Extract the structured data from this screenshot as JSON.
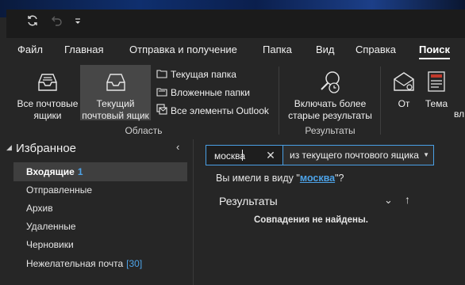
{
  "quick_access": {
    "sync_icon": "sync-icon",
    "undo_icon": "undo-icon",
    "more_icon": "customize-quick-access-icon"
  },
  "tabs": [
    {
      "label": "Файл"
    },
    {
      "label": "Главная"
    },
    {
      "label": "Отправка и получение"
    },
    {
      "label": "Папка"
    },
    {
      "label": "Вид"
    },
    {
      "label": "Справка"
    },
    {
      "label": "Поиск",
      "active": true
    }
  ],
  "ribbon": {
    "scope_group": {
      "label": "Область",
      "all_mailboxes": "Все почтовые ящики",
      "current_mailbox": "Текущий почтовый ящик",
      "current_folder": "Текущая папка",
      "subfolders": "Вложенные папки",
      "all_outlook": "Все элементы Outlook"
    },
    "results_group": {
      "label": "Результаты",
      "include_older": "Включать более старые результаты"
    },
    "from_label": "От",
    "subject_label": "Тема",
    "cut_label": "вл"
  },
  "nav": {
    "favorites": "Избранное",
    "folders": [
      {
        "name": "Входящие",
        "count": "1",
        "selected": true
      },
      {
        "name": "Отправленные",
        "count": ""
      },
      {
        "name": "Архив",
        "count": ""
      },
      {
        "name": "Удаленные",
        "count": ""
      },
      {
        "name": "Черновики",
        "count": ""
      },
      {
        "name": "Нежелательная почта",
        "count": "[30]"
      }
    ]
  },
  "search": {
    "query": "москва",
    "scope": "из текущего почтового ящика",
    "suggest_prefix": "Вы имели в виду \"",
    "suggest_term": "москва",
    "suggest_suffix": "\"?",
    "results_heading": "Результаты",
    "no_results": "Совпадения не найдены."
  },
  "colors": {
    "accent": "#4aa0e6",
    "link": "#4da3e8",
    "background": "#262626",
    "selected": "#3f3f3f"
  }
}
